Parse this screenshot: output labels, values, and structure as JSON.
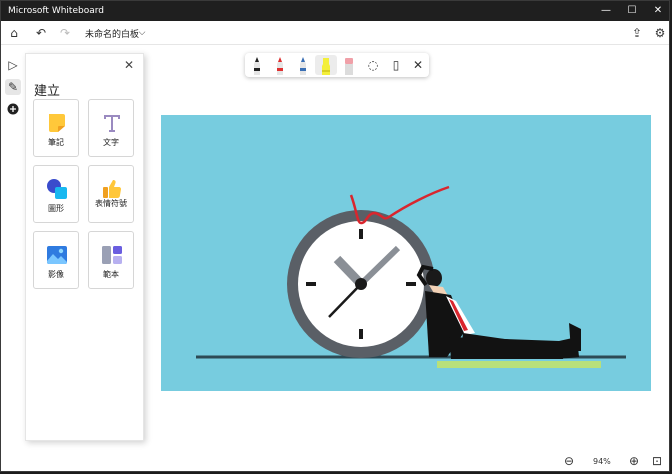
{
  "window": {
    "title": "Microsoft Whiteboard"
  },
  "toolbar": {
    "board_name": "未命名的白板"
  },
  "panel": {
    "heading": "建立",
    "items": [
      {
        "label": "筆記"
      },
      {
        "label": "文字"
      },
      {
        "label": "圖形"
      },
      {
        "label": "表情符號"
      },
      {
        "label": "影像"
      },
      {
        "label": "範本"
      }
    ]
  },
  "pens": [
    {
      "name": "black-pen",
      "color": "#222222"
    },
    {
      "name": "red-pen",
      "color": "#e03030"
    },
    {
      "name": "blue-pen",
      "color": "#3a6fb5"
    },
    {
      "name": "highlighter",
      "color": "#f3ef3a"
    },
    {
      "name": "eraser",
      "color": "#f0a0a8"
    }
  ],
  "zoom": {
    "level": "94%"
  },
  "colors": {
    "canvas_bg": "#77ccdf",
    "highlight": "#b8e07a",
    "ink_red": "#d9262e"
  }
}
